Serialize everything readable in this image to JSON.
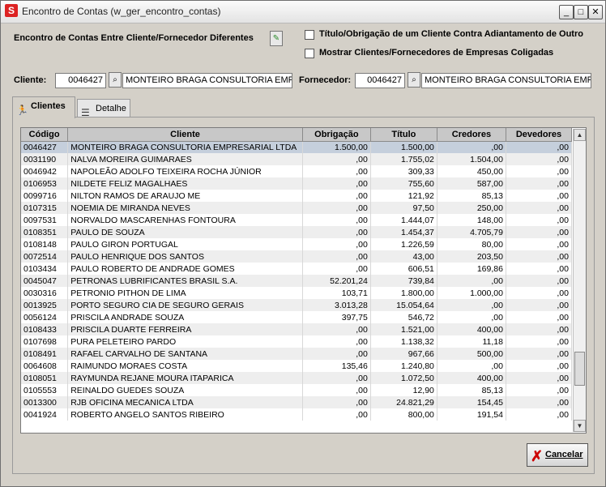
{
  "window": {
    "icon_letter": "S",
    "title": "Encontro de Contas (w_ger_encontro_contas)",
    "min": "_",
    "max": "□",
    "close": "✕"
  },
  "options": {
    "label_diferentes": "Encontro de Contas Entre Cliente/Fornecedor Diferentes",
    "chk_titulo": "Título/Obrigação de um Cliente Contra Adiantamento de Outro",
    "chk_coligadas": "Mostrar Clientes/Fornecedores de Empresas Coligadas"
  },
  "cliente": {
    "label": "Cliente:",
    "code": "0046427",
    "name": "MONTEIRO BRAGA CONSULTORIA EMPRES"
  },
  "fornecedor": {
    "label": "Fornecedor:",
    "code": "0046427",
    "name": "MONTEIRO BRAGA CONSULTORIA EMPRES"
  },
  "tabs": [
    {
      "label": "Clientes",
      "icon": "person-run-icon"
    },
    {
      "label": "Detalhe",
      "icon": "list-icon"
    }
  ],
  "table": {
    "columns": [
      "Código",
      "Cliente",
      "Obrigação",
      "Título",
      "Credores",
      "Devedores"
    ],
    "rows": [
      [
        "0046427",
        "MONTEIRO BRAGA CONSULTORIA EMPRESARIAL LTDA",
        "1.500,00",
        "1.500,00",
        ",00",
        ",00"
      ],
      [
        "0031190",
        "NALVA MOREIRA GUIMARAES",
        ",00",
        "1.755,02",
        "1.504,00",
        ",00"
      ],
      [
        "0046942",
        "NAPOLEÃO ADOLFO TEIXEIRA ROCHA JÚNIOR",
        ",00",
        "309,33",
        "450,00",
        ",00"
      ],
      [
        "0106953",
        "NILDETE FELIZ MAGALHAES",
        ",00",
        "755,60",
        "587,00",
        ",00"
      ],
      [
        "0099716",
        "NILTON RAMOS DE ARAUJO ME",
        ",00",
        "121,92",
        "85,13",
        ",00"
      ],
      [
        "0107315",
        "NOEMIA DE MIRANDA NEVES",
        ",00",
        "97,50",
        "250,00",
        ",00"
      ],
      [
        "0097531",
        "NORVALDO MASCARENHAS FONTOURA",
        ",00",
        "1.444,07",
        "148,00",
        ",00"
      ],
      [
        "0108351",
        "PAULO DE SOUZA",
        ",00",
        "1.454,37",
        "4.705,79",
        ",00"
      ],
      [
        "0108148",
        "PAULO GIRON PORTUGAL",
        ",00",
        "1.226,59",
        "80,00",
        ",00"
      ],
      [
        "0072514",
        "PAULO HENRIQUE DOS SANTOS",
        ",00",
        "43,00",
        "203,50",
        ",00"
      ],
      [
        "0103434",
        "PAULO ROBERTO DE ANDRADE GOMES",
        ",00",
        "606,51",
        "169,86",
        ",00"
      ],
      [
        "0045047",
        "PETRONAS LUBRIFICANTES BRASIL S.A.",
        "52.201,24",
        "739,84",
        ",00",
        ",00"
      ],
      [
        "0030316",
        "PETRONIO PITHON DE LIMA",
        "103,71",
        "1.800,00",
        "1.000,00",
        ",00"
      ],
      [
        "0013925",
        "PORTO SEGURO CIA DE SEGURO GERAIS",
        "3.013,28",
        "15.054,64",
        ",00",
        ",00"
      ],
      [
        "0056124",
        "PRISCILA ANDRADE SOUZA",
        "397,75",
        "546,72",
        ",00",
        ",00"
      ],
      [
        "0108433",
        "PRISCILA DUARTE FERREIRA",
        ",00",
        "1.521,00",
        "400,00",
        ",00"
      ],
      [
        "0107698",
        "PURA PELETEIRO PARDO",
        ",00",
        "1.138,32",
        "11,18",
        ",00"
      ],
      [
        "0108491",
        "RAFAEL CARVALHO DE SANTANA",
        ",00",
        "967,66",
        "500,00",
        ",00"
      ],
      [
        "0064608",
        "RAIMUNDO MORAES COSTA",
        "135,46",
        "1.240,80",
        ",00",
        ",00"
      ],
      [
        "0108051",
        "RAYMUNDA REJANE MOURA ITAPARICA",
        ",00",
        "1.072,50",
        "400,00",
        ",00"
      ],
      [
        "0105553",
        "REINALDO GUEDES SOUZA",
        ",00",
        "12,90",
        "85,13",
        ",00"
      ],
      [
        "0013300",
        "RJB OFICINA MECANICA LTDA",
        ",00",
        "24.821,29",
        "154,45",
        ",00"
      ],
      [
        "0041924",
        "ROBERTO ANGELO SANTOS RIBEIRO",
        ",00",
        "800,00",
        "191,54",
        ",00"
      ]
    ],
    "selected_row": 0
  },
  "buttons": {
    "cancel": "Cancelar"
  }
}
